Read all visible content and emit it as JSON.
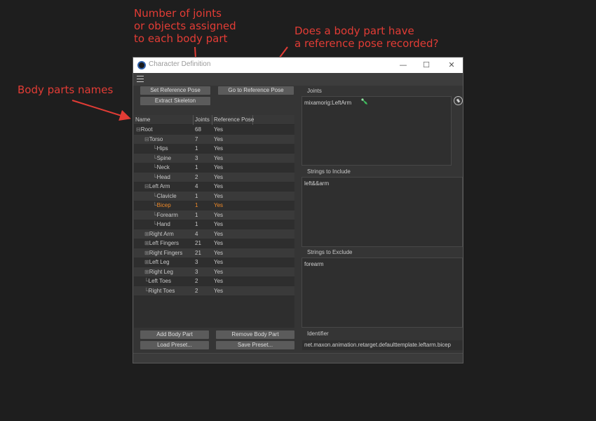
{
  "annotations": {
    "joints_count": "Number of joints\nor objects assigned\nto each body part",
    "reference_pose": "Does a body part have\na reference pose recorded?",
    "body_parts": "Body parts names"
  },
  "window": {
    "title": "Character Definition",
    "controls": {
      "minimize": "—",
      "maximize": "☐",
      "close": "✕"
    }
  },
  "toolbar": {
    "set_reference_pose": "Set Reference Pose",
    "go_to_reference_pose": "Go to Reference Pose",
    "extract_skeleton": "Extract Skeleton"
  },
  "tree": {
    "columns": [
      "Name",
      "Joints",
      "Reference Pose"
    ],
    "rows": [
      {
        "name": "Root",
        "joints": "68",
        "ref": "Yes",
        "prefix": "⊟",
        "depth": 0
      },
      {
        "name": "Torso",
        "joints": "7",
        "ref": "Yes",
        "prefix": "⊟",
        "depth": 1
      },
      {
        "name": "Hips",
        "joints": "1",
        "ref": "Yes",
        "prefix": "└",
        "depth": 2
      },
      {
        "name": "Spine",
        "joints": "3",
        "ref": "Yes",
        "prefix": "└",
        "depth": 2
      },
      {
        "name": "Neck",
        "joints": "1",
        "ref": "Yes",
        "prefix": "└",
        "depth": 2
      },
      {
        "name": "Head",
        "joints": "2",
        "ref": "Yes",
        "prefix": "└",
        "depth": 2
      },
      {
        "name": "Left Arm",
        "joints": "4",
        "ref": "Yes",
        "prefix": "⊟",
        "depth": 1
      },
      {
        "name": "Clavicle",
        "joints": "1",
        "ref": "Yes",
        "prefix": "└",
        "depth": 2
      },
      {
        "name": "Bicep",
        "joints": "1",
        "ref": "Yes",
        "prefix": "└",
        "depth": 2,
        "selected": true
      },
      {
        "name": "Forearm",
        "joints": "1",
        "ref": "Yes",
        "prefix": "└",
        "depth": 2
      },
      {
        "name": "Hand",
        "joints": "1",
        "ref": "Yes",
        "prefix": "└",
        "depth": 2
      },
      {
        "name": "Right Arm",
        "joints": "4",
        "ref": "Yes",
        "prefix": "⊞",
        "depth": 1
      },
      {
        "name": "Left Fingers",
        "joints": "21",
        "ref": "Yes",
        "prefix": "⊞",
        "depth": 1
      },
      {
        "name": "Right Fingers",
        "joints": "21",
        "ref": "Yes",
        "prefix": "⊞",
        "depth": 1
      },
      {
        "name": "Left Leg",
        "joints": "3",
        "ref": "Yes",
        "prefix": "⊞",
        "depth": 1
      },
      {
        "name": "Right Leg",
        "joints": "3",
        "ref": "Yes",
        "prefix": "⊞",
        "depth": 1
      },
      {
        "name": "Left Toes",
        "joints": "2",
        "ref": "Yes",
        "prefix": "└",
        "depth": 1
      },
      {
        "name": "Right Toes",
        "joints": "2",
        "ref": "Yes",
        "prefix": "└",
        "depth": 1
      }
    ]
  },
  "bottom_buttons": {
    "add_body_part": "Add Body Part",
    "remove_body_part": "Remove Body Part",
    "load_preset": "Load Preset...",
    "save_preset": "Save Preset..."
  },
  "right_panel": {
    "joints_label": "Joints",
    "joint_value": "mixamorig:LeftArm",
    "include_label": "Strings to Include",
    "include_value": "left&&arm",
    "exclude_label": "Strings to Exclude",
    "exclude_value": "forearm",
    "identifier_label": "Identifier",
    "identifier_value": "net.maxon.animation.retarget.defaulttemplate.leftarm.bicep"
  },
  "colors": {
    "annotation": "#e23c35",
    "selected_row": "#f08a28",
    "joint_icon": "#3dbb5c"
  },
  "icons": [
    "app-icon",
    "hamburger-menu-icon",
    "pick-object-icon",
    "joint-icon"
  ]
}
